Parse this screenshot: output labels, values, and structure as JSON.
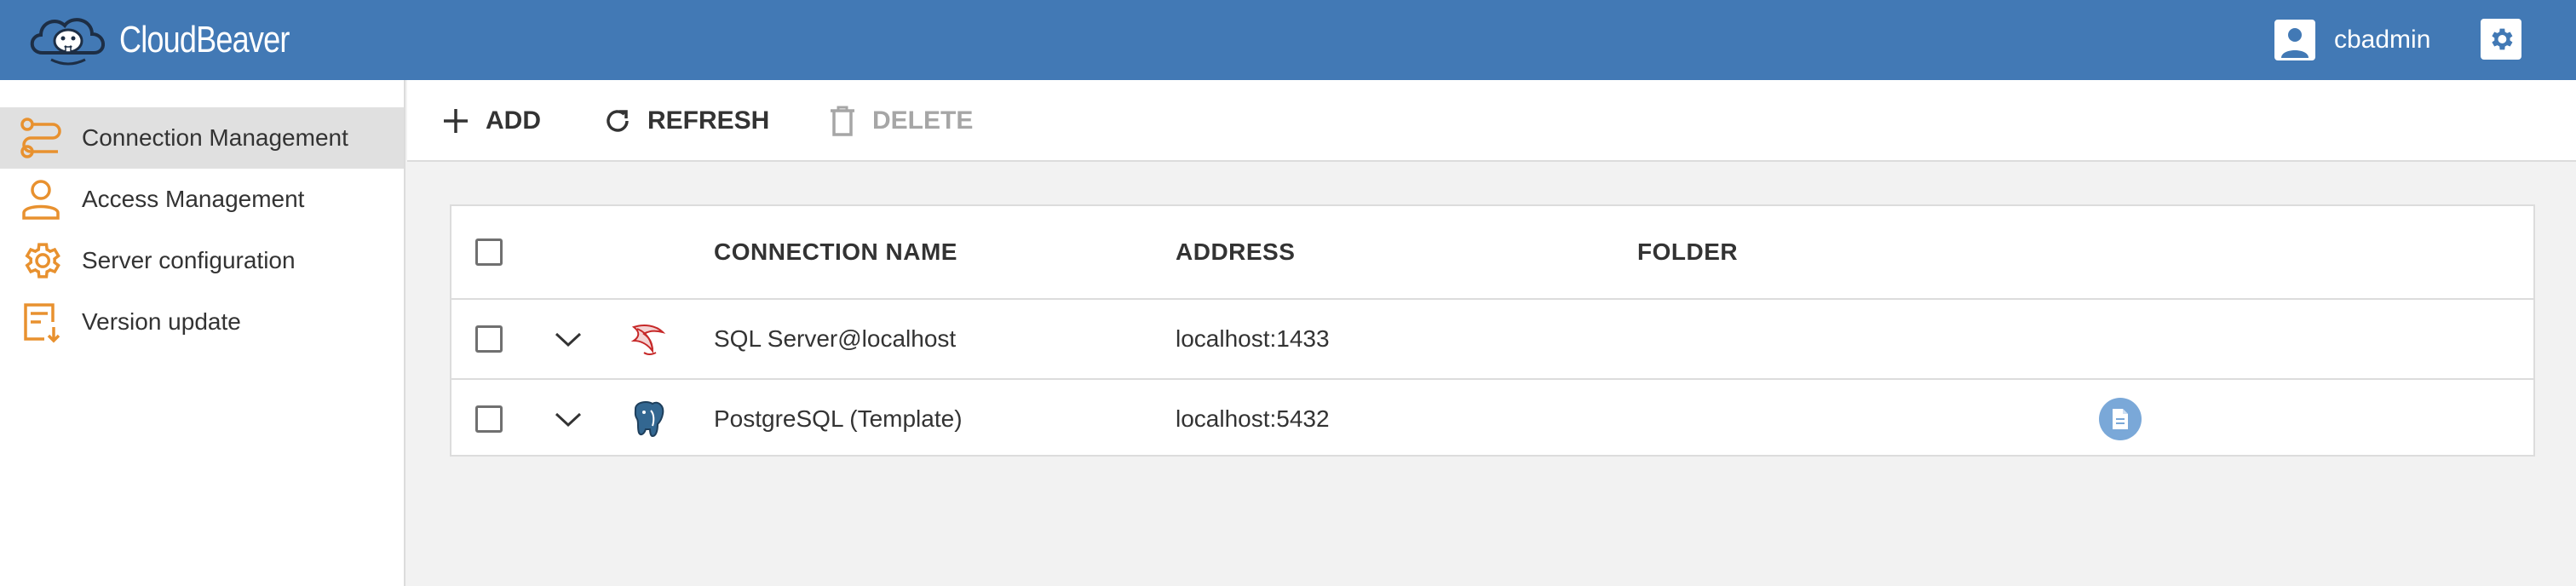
{
  "app": {
    "name": "CloudBeaver",
    "user": "cbadmin",
    "colors": {
      "header": "#4279b5",
      "accent": "#e8912f",
      "badge": "#7aa8d8"
    }
  },
  "sidebar": {
    "items": [
      {
        "label": "Connection Management",
        "icon": "connection-icon",
        "active": true
      },
      {
        "label": "Access Management",
        "icon": "user-icon",
        "active": false
      },
      {
        "label": "Server configuration",
        "icon": "gear-icon",
        "active": false
      },
      {
        "label": "Version update",
        "icon": "version-update-icon",
        "active": false
      }
    ]
  },
  "toolbar": {
    "add_label": "ADD",
    "refresh_label": "REFRESH",
    "delete_label": "DELETE"
  },
  "table": {
    "columns": [
      "CONNECTION NAME",
      "ADDRESS",
      "FOLDER"
    ],
    "rows": [
      {
        "name": "SQL Server@localhost",
        "address": "localhost:1433",
        "folder": "",
        "icon": "sql-server-icon",
        "has_badge": false
      },
      {
        "name": "PostgreSQL (Template)",
        "address": "localhost:5432",
        "folder": "",
        "icon": "postgresql-icon",
        "has_badge": true
      }
    ]
  }
}
